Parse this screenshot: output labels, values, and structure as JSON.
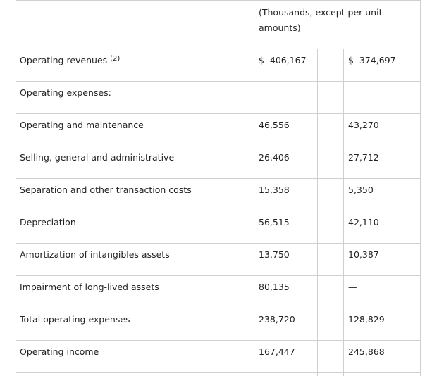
{
  "header": {
    "units": "(Thousands, except per unit amounts)"
  },
  "rows": [
    {
      "label": "Operating revenues",
      "note": "(2)",
      "col1": "$  406,167",
      "col2": "$  374,697"
    },
    {
      "label": "Operating expenses:",
      "note": "",
      "col1": "",
      "col2": ""
    },
    {
      "label": "Operating and maintenance",
      "note": "",
      "col1": "46,556",
      "col2": "43,270"
    },
    {
      "label": "Selling, general and administrative",
      "note": "",
      "col1": "26,406",
      "col2": "27,712"
    },
    {
      "label": "Separation and other transaction costs",
      "note": "",
      "col1": "15,358",
      "col2": "5,350"
    },
    {
      "label": "Depreciation",
      "note": "",
      "col1": "56,515",
      "col2": "42,110"
    },
    {
      "label": "Amortization of intangibles assets",
      "note": "",
      "col1": "13,750",
      "col2": "10,387"
    },
    {
      "label": "Impairment of long-lived assets",
      "note": "",
      "col1": "80,135",
      "col2": "—"
    },
    {
      "label": "Total operating expenses",
      "note": "",
      "col1": "238,720",
      "col2": "128,829"
    },
    {
      "label": "Operating income",
      "note": "",
      "col1": "167,447",
      "col2": "245,868"
    }
  ]
}
